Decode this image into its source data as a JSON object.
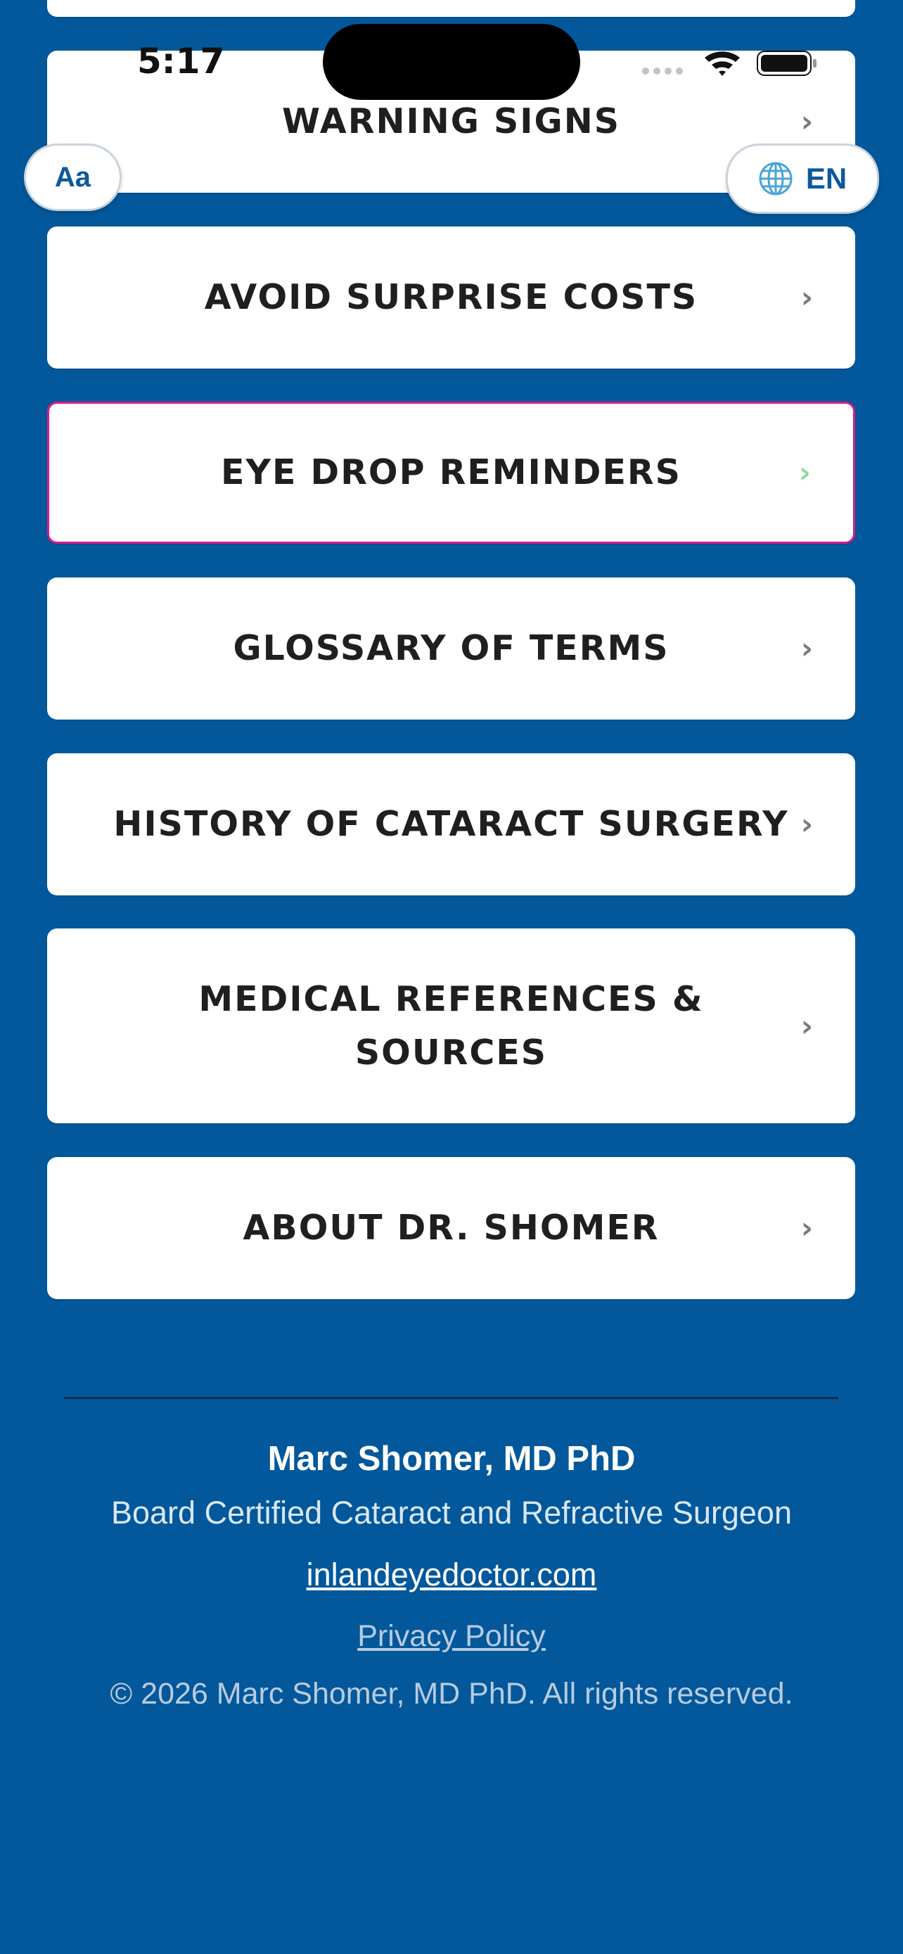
{
  "status_bar": {
    "time": "5:17"
  },
  "controls": {
    "font_button_label": "Aa",
    "language_label": "EN",
    "language_icon": "globe-icon"
  },
  "menu": {
    "items": [
      {
        "label": "WARNING SIGNS",
        "chevron": "›",
        "icon": "chevron-right-icon"
      },
      {
        "label": "AVOID SURPRISE COSTS",
        "chevron": "›",
        "icon": "chevron-right-icon"
      },
      {
        "label": "EYE DROP REMINDERS",
        "chevron": "›",
        "icon": "chevron-right-icon"
      },
      {
        "label": "GLOSSARY OF TERMS",
        "chevron": "›",
        "icon": "chevron-right-icon"
      },
      {
        "label": "HISTORY OF CATARACT SURGERY",
        "chevron": "›",
        "icon": "chevron-right-icon"
      },
      {
        "label": "MEDICAL REFERENCES & SOURCES",
        "chevron": "›",
        "icon": "chevron-right-icon"
      },
      {
        "label": "ABOUT DR. SHOMER",
        "chevron": "›",
        "icon": "chevron-right-icon"
      }
    ]
  },
  "footer": {
    "name": "Marc Shomer, MD PhD",
    "title": "Board Certified Cataract and Refractive Surgeon",
    "website": "inlandeyedoctor.com",
    "privacy": "Privacy Policy",
    "copyright": "© 2026 Marc Shomer, MD PhD. All rights reserved."
  },
  "colors": {
    "background": "#02589b",
    "card": "#ffffff",
    "active_border": "#d81b8a",
    "active_chevron": "#8fdc9a"
  }
}
